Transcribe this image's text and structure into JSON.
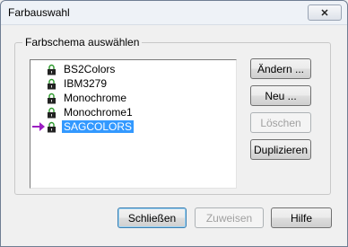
{
  "window": {
    "title": "Farbauswahl",
    "close_symbol": "✕"
  },
  "group": {
    "title": "Farbschema auswählen"
  },
  "list": {
    "items": [
      {
        "label": "BS2Colors",
        "selected": false,
        "current": false
      },
      {
        "label": "IBM3279",
        "selected": false,
        "current": false
      },
      {
        "label": "Monochrome",
        "selected": false,
        "current": false
      },
      {
        "label": "Monochrome1",
        "selected": false,
        "current": false
      },
      {
        "label": "SAGCOLORS",
        "selected": true,
        "current": true
      }
    ],
    "lock_icon": "lock-icon",
    "current_icon": "arrow-right-icon",
    "arrow_color": "#9b1fc1",
    "lock_color": "#2e9a2e"
  },
  "side_buttons": {
    "change": "Ändern ...",
    "new": "Neu ...",
    "delete": "Löschen",
    "duplicate": "Duplizieren"
  },
  "bottom_buttons": {
    "close": "Schließen",
    "assign": "Zuweisen",
    "help": "Hilfe"
  }
}
